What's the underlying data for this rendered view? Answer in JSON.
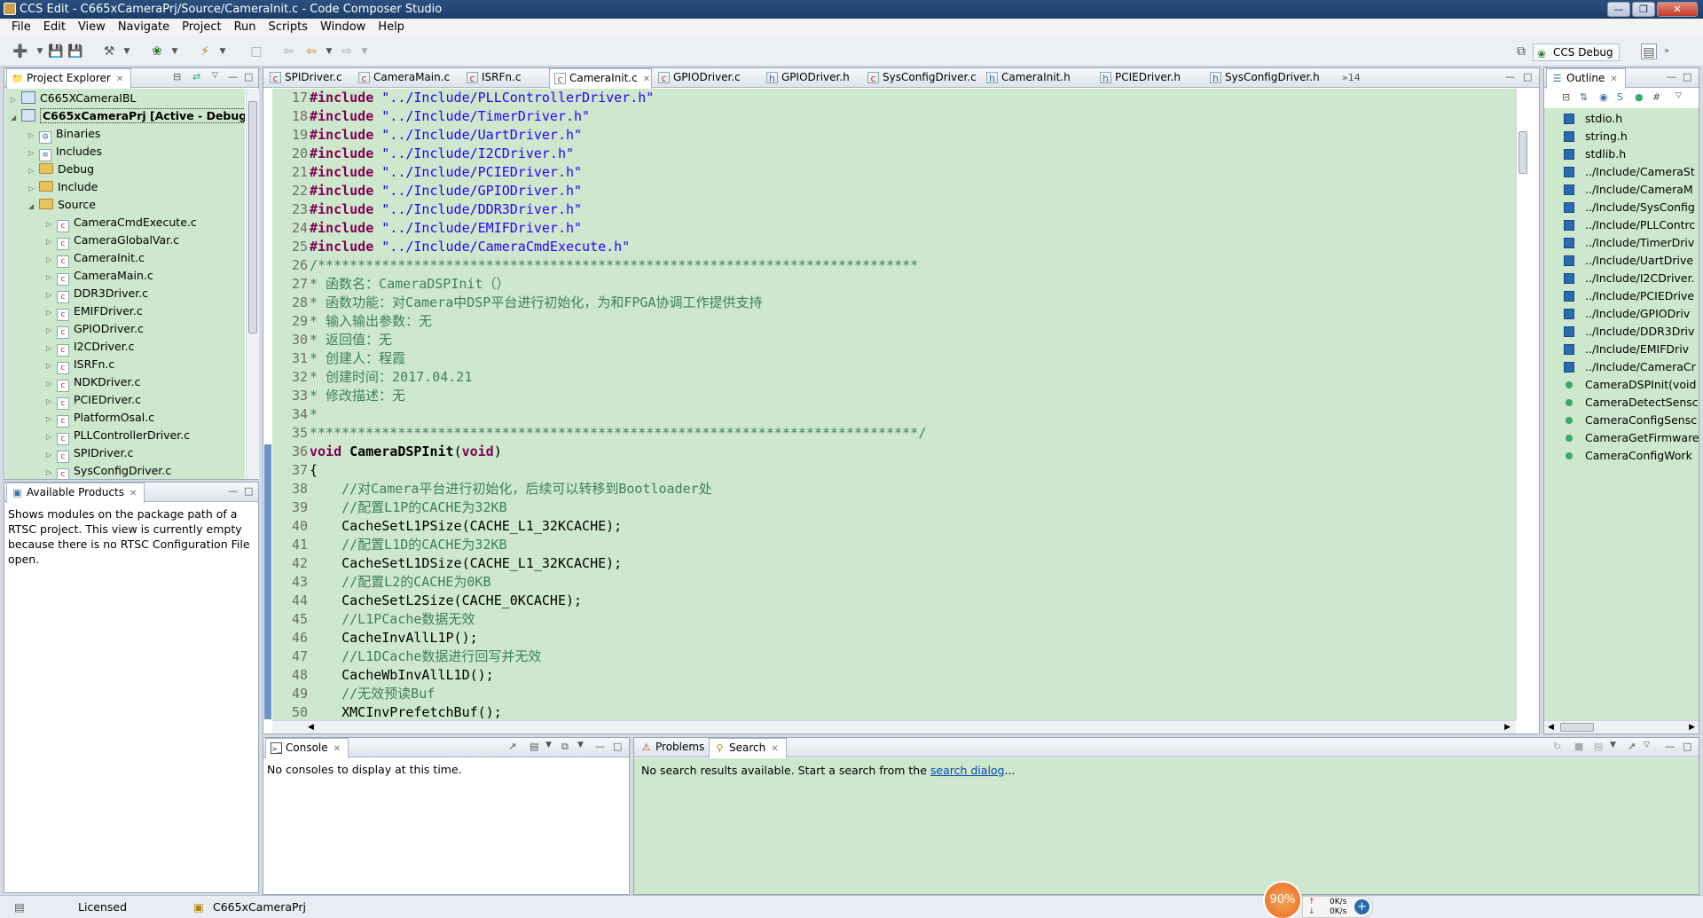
{
  "window": {
    "title": "CCS Edit - C665xCameraPrj/Source/CameraInit.c - Code Composer Studio",
    "controls": [
      "minimize",
      "maximize",
      "close"
    ]
  },
  "menu": [
    "File",
    "Edit",
    "View",
    "Navigate",
    "Project",
    "Run",
    "Scripts",
    "Window",
    "Help"
  ],
  "perspective": {
    "label": "CCS Debug"
  },
  "project_explorer": {
    "tab": "Project Explorer",
    "items": [
      {
        "label": "C665XCameraIBL",
        "depth": 0,
        "kind": "project",
        "expanded": false
      },
      {
        "label": "C665xCameraPrj  [Active - Debug]",
        "depth": 0,
        "kind": "project",
        "expanded": true,
        "bold": true
      },
      {
        "label": "Binaries",
        "depth": 1,
        "kind": "binaries"
      },
      {
        "label": "Includes",
        "depth": 1,
        "kind": "includes"
      },
      {
        "label": "Debug",
        "depth": 1,
        "kind": "folder"
      },
      {
        "label": "Include",
        "depth": 1,
        "kind": "folder"
      },
      {
        "label": "Source",
        "depth": 1,
        "kind": "folder",
        "expanded": true
      },
      {
        "label": "CameraCmdExecute.c",
        "depth": 2,
        "kind": "file"
      },
      {
        "label": "CameraGlobalVar.c",
        "depth": 2,
        "kind": "file"
      },
      {
        "label": "CameraInit.c",
        "depth": 2,
        "kind": "file"
      },
      {
        "label": "CameraMain.c",
        "depth": 2,
        "kind": "file"
      },
      {
        "label": "DDR3Driver.c",
        "depth": 2,
        "kind": "file"
      },
      {
        "label": "EMIFDriver.c",
        "depth": 2,
        "kind": "file"
      },
      {
        "label": "GPIODriver.c",
        "depth": 2,
        "kind": "file"
      },
      {
        "label": "I2CDriver.c",
        "depth": 2,
        "kind": "file"
      },
      {
        "label": "ISRFn.c",
        "depth": 2,
        "kind": "file"
      },
      {
        "label": "NDKDriver.c",
        "depth": 2,
        "kind": "file"
      },
      {
        "label": "PCIEDriver.c",
        "depth": 2,
        "kind": "file"
      },
      {
        "label": "PlatformOsal.c",
        "depth": 2,
        "kind": "file"
      },
      {
        "label": "PLLControllerDriver.c",
        "depth": 2,
        "kind": "file"
      },
      {
        "label": "SPIDriver.c",
        "depth": 2,
        "kind": "file"
      },
      {
        "label": "SysConfigDriver.c",
        "depth": 2,
        "kind": "file"
      }
    ]
  },
  "available_products": {
    "tab": "Available Products",
    "text": "Shows modules on the package path of a RTSC project. This view is currently empty because there is no RTSC Configuration File open."
  },
  "editor": {
    "tabs": [
      {
        "label": "SPIDriver.c",
        "icon": "c"
      },
      {
        "label": "CameraMain.c",
        "icon": "c"
      },
      {
        "label": "ISRFn.c",
        "icon": "c"
      },
      {
        "label": "CameraInit.c",
        "icon": "c",
        "active": true
      },
      {
        "label": "GPIODriver.c",
        "icon": "c"
      },
      {
        "label": "GPIODriver.h",
        "icon": "h"
      },
      {
        "label": "SysConfigDriver.c",
        "icon": "c"
      },
      {
        "label": "CameraInit.h",
        "icon": "h"
      },
      {
        "label": "PCIEDriver.h",
        "icon": "h"
      },
      {
        "label": "SysConfigDriver.h",
        "icon": "h"
      }
    ],
    "overflow": "»14",
    "lines": [
      {
        "n": "17",
        "parts": [
          [
            "kw",
            "#include "
          ],
          [
            "str",
            "\"../Include/PLLControllerDriver.h\""
          ]
        ]
      },
      {
        "n": "18",
        "parts": [
          [
            "kw",
            "#include "
          ],
          [
            "str",
            "\"../Include/TimerDriver.h\""
          ]
        ]
      },
      {
        "n": "19",
        "parts": [
          [
            "kw",
            "#include "
          ],
          [
            "str",
            "\"../Include/UartDriver.h\""
          ]
        ]
      },
      {
        "n": "20",
        "parts": [
          [
            "kw",
            "#include "
          ],
          [
            "str",
            "\"../Include/I2CDriver.h\""
          ]
        ]
      },
      {
        "n": "21",
        "parts": [
          [
            "kw",
            "#include "
          ],
          [
            "str",
            "\"../Include/PCIEDriver.h\""
          ]
        ]
      },
      {
        "n": "22",
        "parts": [
          [
            "kw",
            "#include "
          ],
          [
            "str",
            "\"../Include/GPIODriver.h\""
          ]
        ]
      },
      {
        "n": "23",
        "parts": [
          [
            "kw",
            "#include "
          ],
          [
            "str",
            "\"../Include/DDR3Driver.h\""
          ]
        ]
      },
      {
        "n": "24",
        "parts": [
          [
            "kw",
            "#include "
          ],
          [
            "str",
            "\"../Include/EMIFDriver.h\""
          ]
        ]
      },
      {
        "n": "25",
        "parts": [
          [
            "kw",
            "#include "
          ],
          [
            "str",
            "\"../Include/CameraCmdExecute.h\""
          ]
        ]
      },
      {
        "n": "26",
        "parts": [
          [
            "com",
            "/***************************************************************************"
          ]
        ]
      },
      {
        "n": "27",
        "parts": [
          [
            "com",
            "* 函数名：CameraDSPInit（）"
          ]
        ]
      },
      {
        "n": "28",
        "parts": [
          [
            "com",
            "* 函数功能：对Camera中DSP平台进行初始化，为和FPGA协调工作提供支持"
          ]
        ]
      },
      {
        "n": "29",
        "parts": [
          [
            "com",
            "* 输入输出参数：无"
          ]
        ]
      },
      {
        "n": "30",
        "parts": [
          [
            "com",
            "* 返回值：无"
          ]
        ]
      },
      {
        "n": "31",
        "parts": [
          [
            "com",
            "* 创建人：程霞"
          ]
        ]
      },
      {
        "n": "32",
        "parts": [
          [
            "com",
            "* 创建时间：2017.04.21"
          ]
        ]
      },
      {
        "n": "33",
        "parts": [
          [
            "com",
            "* 修改描述：无"
          ]
        ]
      },
      {
        "n": "34",
        "parts": [
          [
            "com",
            "*"
          ]
        ]
      },
      {
        "n": "35",
        "parts": [
          [
            "com",
            "****************************************************************************/"
          ]
        ]
      },
      {
        "n": "36",
        "parts": [
          [
            "kw",
            "void "
          ],
          [
            "fn",
            "CameraDSPInit"
          ],
          [
            "pl",
            "("
          ],
          [
            "kw",
            "void"
          ],
          [
            "pl",
            ")"
          ]
        ]
      },
      {
        "n": "37",
        "parts": [
          [
            "pl",
            "{"
          ]
        ]
      },
      {
        "n": "38",
        "parts": [
          [
            "pl",
            "    "
          ],
          [
            "com",
            "//对Camera平台进行初始化，后续可以转移到Bootloader处"
          ]
        ]
      },
      {
        "n": "39",
        "parts": [
          [
            "pl",
            "    "
          ],
          [
            "com",
            "//配置L1P的CACHE为32KB"
          ]
        ]
      },
      {
        "n": "40",
        "parts": [
          [
            "pl",
            "    CacheSetL1PSize(CACHE_L1_32KCACHE);"
          ]
        ]
      },
      {
        "n": "41",
        "parts": [
          [
            "pl",
            "    "
          ],
          [
            "com",
            "//配置L1D的CACHE为32KB"
          ]
        ]
      },
      {
        "n": "42",
        "parts": [
          [
            "pl",
            "    CacheSetL1DSize(CACHE_L1_32KCACHE);"
          ]
        ]
      },
      {
        "n": "43",
        "parts": [
          [
            "pl",
            "    "
          ],
          [
            "com",
            "//配置L2的CACHE为0KB"
          ]
        ]
      },
      {
        "n": "44",
        "parts": [
          [
            "pl",
            "    CacheSetL2Size(CACHE_0KCACHE);"
          ]
        ]
      },
      {
        "n": "45",
        "parts": [
          [
            "pl",
            "    "
          ],
          [
            "com",
            "//L1PCache数据无效"
          ]
        ]
      },
      {
        "n": "46",
        "parts": [
          [
            "pl",
            "    CacheInvAllL1P();"
          ]
        ]
      },
      {
        "n": "47",
        "parts": [
          [
            "pl",
            "    "
          ],
          [
            "com",
            "//L1DCache数据进行回写并无效"
          ]
        ]
      },
      {
        "n": "48",
        "parts": [
          [
            "pl",
            "    CacheWbInvAllL1D();"
          ]
        ]
      },
      {
        "n": "49",
        "parts": [
          [
            "pl",
            "    "
          ],
          [
            "com",
            "//无效预读Buf"
          ]
        ]
      },
      {
        "n": "50",
        "parts": [
          [
            "pl",
            "    XMCInvPrefetchBuf();"
          ]
        ]
      }
    ]
  },
  "outline": {
    "tab": "Outline",
    "items": [
      {
        "label": "stdio.h",
        "kind": "include"
      },
      {
        "label": "string.h",
        "kind": "include"
      },
      {
        "label": "stdlib.h",
        "kind": "include"
      },
      {
        "label": "../Include/CameraSt",
        "kind": "include"
      },
      {
        "label": "../Include/CameraM",
        "kind": "include"
      },
      {
        "label": "../Include/SysConfig",
        "kind": "include"
      },
      {
        "label": "../Include/PLLContrc",
        "kind": "include"
      },
      {
        "label": "../Include/TimerDriv",
        "kind": "include"
      },
      {
        "label": "../Include/UartDrive",
        "kind": "include"
      },
      {
        "label": "../Include/I2CDriver.",
        "kind": "include"
      },
      {
        "label": "../Include/PCIEDrive",
        "kind": "include"
      },
      {
        "label": "../Include/GPIODriv",
        "kind": "include"
      },
      {
        "label": "../Include/DDR3Driv",
        "kind": "include"
      },
      {
        "label": "../Include/EMIFDriv",
        "kind": "include"
      },
      {
        "label": "../Include/CameraCr",
        "kind": "include"
      },
      {
        "label": "CameraDSPInit(void",
        "kind": "function"
      },
      {
        "label": "CameraDetectSensc",
        "kind": "function"
      },
      {
        "label": "CameraConfigSensc",
        "kind": "function"
      },
      {
        "label": "CameraGetFirmware",
        "kind": "function"
      },
      {
        "label": "CameraConfigWork",
        "kind": "function"
      }
    ]
  },
  "console": {
    "tab": "Console",
    "text": "No consoles to display at this time."
  },
  "search_panel": {
    "tabs": [
      "Problems",
      "Search"
    ],
    "text_before": "No search results available. Start a search from the ",
    "link": "search dialog",
    "text_after": "..."
  },
  "statusbar": {
    "licensed": "Licensed",
    "project": "C665xCameraPrj"
  },
  "net_widget": {
    "percent": "90%",
    "up": "0K/s",
    "down": "0K/s"
  }
}
